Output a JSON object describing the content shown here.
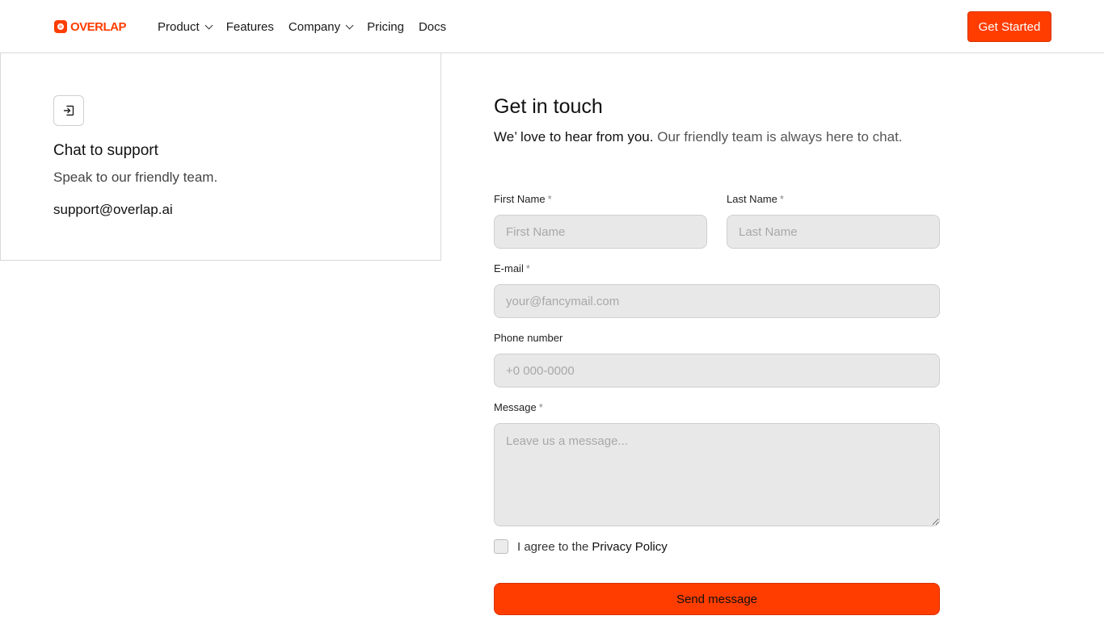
{
  "brand": {
    "name": "OVERLAP",
    "accent": "#ff3d00"
  },
  "nav": {
    "items": [
      {
        "label": "Product",
        "dropdown": true
      },
      {
        "label": "Features",
        "dropdown": false
      },
      {
        "label": "Company",
        "dropdown": true
      },
      {
        "label": "Pricing",
        "dropdown": false
      },
      {
        "label": "Docs",
        "dropdown": false
      }
    ],
    "cta_label": "Get Started"
  },
  "support": {
    "icon": "login-icon",
    "title": "Chat to support",
    "subtitle": "Speak to our friendly team.",
    "email": "support@overlap.ai"
  },
  "form": {
    "title": "Get in touch",
    "subtitle_strong": "We’ love to hear from you.",
    "subtitle_rest": "Our friendly team is always here to chat.",
    "first_name": {
      "label": "First Name",
      "required_mark": "*",
      "placeholder": "First Name"
    },
    "last_name": {
      "label": "Last Name",
      "required_mark": "*",
      "placeholder": "Last Name"
    },
    "email": {
      "label": "E-mail",
      "required_mark": "*",
      "placeholder": "your@fancymail.com"
    },
    "phone": {
      "label": "Phone number",
      "placeholder": "+0 000-0000"
    },
    "message": {
      "label": "Message",
      "required_mark": "*",
      "placeholder": "Leave us a message..."
    },
    "agree_text": "I agree to the",
    "agree_link": "Privacy Policy",
    "submit_label": "Send message"
  }
}
